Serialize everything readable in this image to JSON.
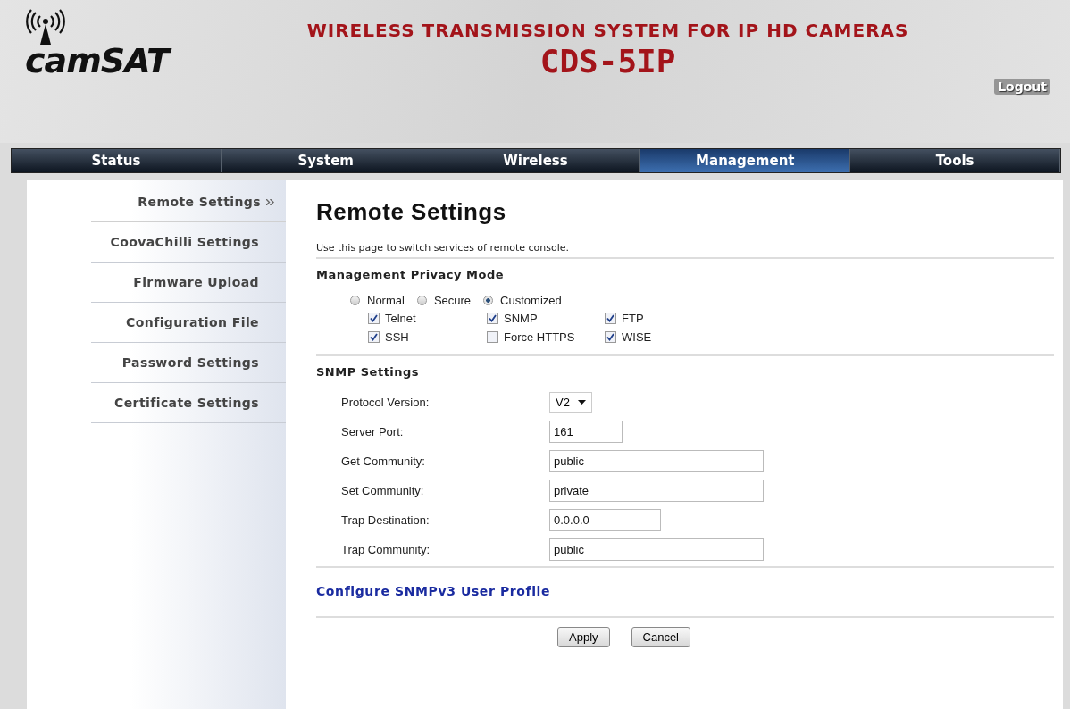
{
  "header": {
    "logo": "camSAT",
    "title": "WIRELESS TRANSMISSION SYSTEM FOR IP HD CAMERAS",
    "model": "CDS-5IP",
    "logout": "Logout"
  },
  "nav": [
    {
      "label": "Status",
      "selected": false
    },
    {
      "label": "System",
      "selected": false
    },
    {
      "label": "Wireless",
      "selected": false
    },
    {
      "label": "Management",
      "selected": true
    },
    {
      "label": "Tools",
      "selected": false
    }
  ],
  "sidebar": {
    "items": [
      {
        "label": "Remote Settings",
        "selected": true
      },
      {
        "label": "CoovaChilli Settings",
        "selected": false
      },
      {
        "label": "Firmware Upload",
        "selected": false
      },
      {
        "label": "Configuration File",
        "selected": false
      },
      {
        "label": "Password Settings",
        "selected": false
      },
      {
        "label": "Certificate Settings",
        "selected": false
      }
    ]
  },
  "page": {
    "title": "Remote Settings",
    "description": "Use this page to switch services of remote console."
  },
  "privacy": {
    "heading": "Management Privacy Mode",
    "modes": [
      {
        "label": "Normal",
        "selected": false
      },
      {
        "label": "Secure",
        "selected": false
      },
      {
        "label": "Customized",
        "selected": true
      }
    ],
    "services": [
      {
        "label": "Telnet",
        "checked": true
      },
      {
        "label": "SNMP",
        "checked": true
      },
      {
        "label": "FTP",
        "checked": true
      },
      {
        "label": "SSH",
        "checked": true
      },
      {
        "label": "Force HTTPS",
        "checked": false
      },
      {
        "label": "WISE",
        "checked": true
      }
    ]
  },
  "snmp": {
    "heading": "SNMP Settings",
    "fields": [
      {
        "label": "Protocol Version:",
        "kind": "select",
        "value": "V2"
      },
      {
        "label": "Server Port:",
        "kind": "text",
        "value": "161"
      },
      {
        "label": "Get Community:",
        "kind": "text",
        "value": "public"
      },
      {
        "label": "Set Community:",
        "kind": "text",
        "value": "private"
      },
      {
        "label": "Trap Destination:",
        "kind": "text",
        "value": "0.0.0.0"
      },
      {
        "label": "Trap Community:",
        "kind": "text",
        "value": "public"
      }
    ],
    "link": "Configure SNMPv3 User Profile"
  },
  "buttons": [
    "Apply",
    "Cancel"
  ]
}
